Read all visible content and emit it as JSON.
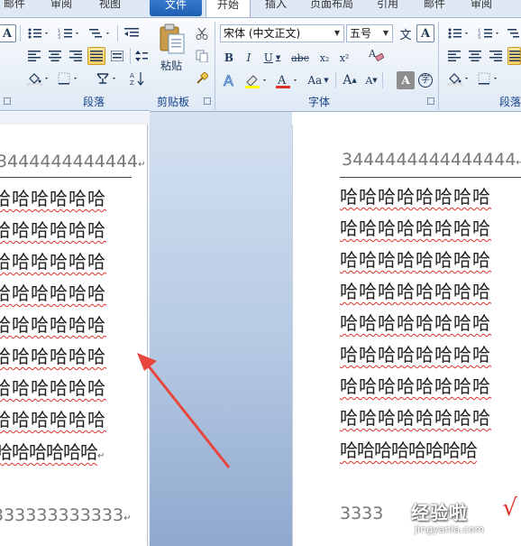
{
  "left_window": {
    "tabs": [
      "邮件",
      "审阅",
      "视图"
    ],
    "paragraph_group_label": "段落",
    "bold_button_label": "A",
    "page": {
      "header_text": "3444444444444",
      "body_lines": [
        "哈哈哈哈哈哈",
        "哈哈哈哈哈哈",
        "哈哈哈哈哈哈",
        "哈哈哈哈哈哈",
        "哈哈哈哈哈哈",
        "哈哈哈哈哈哈",
        "哈哈哈哈哈哈",
        "哈哈哈哈哈哈"
      ],
      "last_line": "哈哈哈哈哈哈",
      "footer_text": "333333333333",
      "paragraph_mark": "↵"
    }
  },
  "right_window": {
    "tabs": {
      "file": "文件",
      "home": "开始",
      "insert": "插入",
      "page_layout": "页面布局",
      "references": "引用",
      "mailings": "邮件",
      "review": "审阅"
    },
    "clipboard": {
      "paste_label": "粘贴",
      "group_label": "剪贴板"
    },
    "font": {
      "font_name": "宋体 (中文正文)",
      "font_size": "五号",
      "group_label": "字体",
      "bold": "B",
      "italic": "I",
      "underline": "U",
      "strikethrough": "abc",
      "subscript": "x₂",
      "superscript": "x²",
      "grow": "A",
      "shrink": "A",
      "change_case": "Aa",
      "phonetic": "文",
      "char_border": "A",
      "char_shading": "A",
      "enclose": "字",
      "clear": "A"
    },
    "paragraph_group_label": "段落",
    "page": {
      "header_text": "3444444444444444",
      "body_lines": [
        "哈哈哈哈哈哈哈哈",
        "哈哈哈哈哈哈哈哈",
        "哈哈哈哈哈哈哈哈",
        "哈哈哈哈哈哈哈哈",
        "哈哈哈哈哈哈哈哈",
        "哈哈哈哈哈哈哈哈",
        "哈哈哈哈哈哈哈哈",
        "哈哈哈哈哈哈哈哈"
      ],
      "last_line": "哈哈哈哈哈哈哈哈",
      "footer_text": "3333",
      "paragraph_mark": "↵"
    }
  },
  "watermark": {
    "title": "经验啦",
    "check": "√",
    "url": "jingyanla.com"
  },
  "colors": {
    "arrow": "#e8453c",
    "ribbon_text": "#15428b",
    "spellcheck": "#e0302a"
  }
}
